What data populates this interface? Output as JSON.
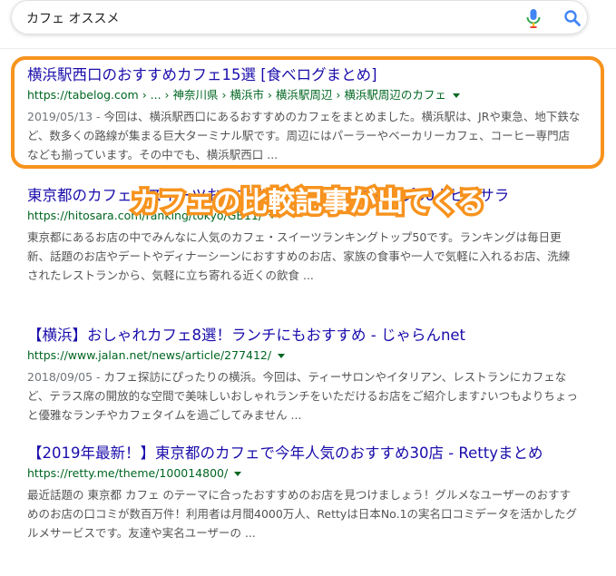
{
  "search": {
    "query": "カフェ オススメ"
  },
  "icons": {
    "mic": "microphone-icon",
    "search": "search-icon",
    "caret": "caret-down-icon"
  },
  "colors": {
    "link": "#1a0dab",
    "url": "#006621",
    "snippet": "#545454",
    "highlight": "#f7931e"
  },
  "callout": {
    "text": "カフェの比較記事が出てくる"
  },
  "results": [
    {
      "title": "横浜駅西口のおすすめカフェ15選 [食べログまとめ]",
      "url": "https://tabelog.com › ... › 神奈川県 › 横浜市 › 横浜駅周辺 › 横浜駅周辺のカフェ",
      "date": "2019/05/13 - ",
      "snippet": "今回は、横浜駅西口にあるおすすめのカフェをまとめました。横浜駅は、JRや東急、地下鉄など、数多くの路線が集まる巨大ターミナル駅です。周辺にはパーラーやベーカリーカフェ、コーヒー専門店なども揃っています。その中でも、横浜駅西口 ..."
    },
    {
      "title": "東京都のカフェ・スイーツおすすめ人気ランキングトップ50 | ヒトサラ",
      "url": "https://hitosara.com/ranking/tokyo/GB11/",
      "date": "",
      "snippet": "東京都にあるお店の中でみんなに人気のカフェ・スイーツランキングトップ50です。ランキングは毎日更新、話題のお店やデートやディナーシーンにおすすめのお店、家族の食事や一人で気軽に入れるお店、洗練されたレストランから、気軽に立ち寄れる近くの飲食 ..."
    },
    {
      "title": "【横浜】おしゃれカフェ8選！ランチにもおすすめ - じゃらんnet",
      "url": "https://www.jalan.net/news/article/277412/",
      "date": "2018/09/05 - ",
      "snippet": "カフェ探訪にぴったりの横浜。今回は、ティーサロンやイタリアン、レストランにカフェなど、テラス席の開放的な空間で美味しいおしゃれランチをいただけるお店をご紹介します♪いつもよりちょっと優雅なランチやカフェタイムを過ごしてみません ..."
    },
    {
      "title": "【2019年最新！】東京都のカフェで今年人気のおすすめ30店 - Rettyまとめ",
      "url": "https://retty.me/theme/100014800/",
      "date": "",
      "snippet": "最近話題の 東京都 カフェ のテーマに合ったおすすめのお店を見つけましょう！グルメなユーザーのおすすめのお店の口コミが数百万件！利用者は月間4000万人、Rettyは日本No.1の実名口コミデータを活かしたグルメサービスです。友達や実名ユーザーの ..."
    }
  ]
}
